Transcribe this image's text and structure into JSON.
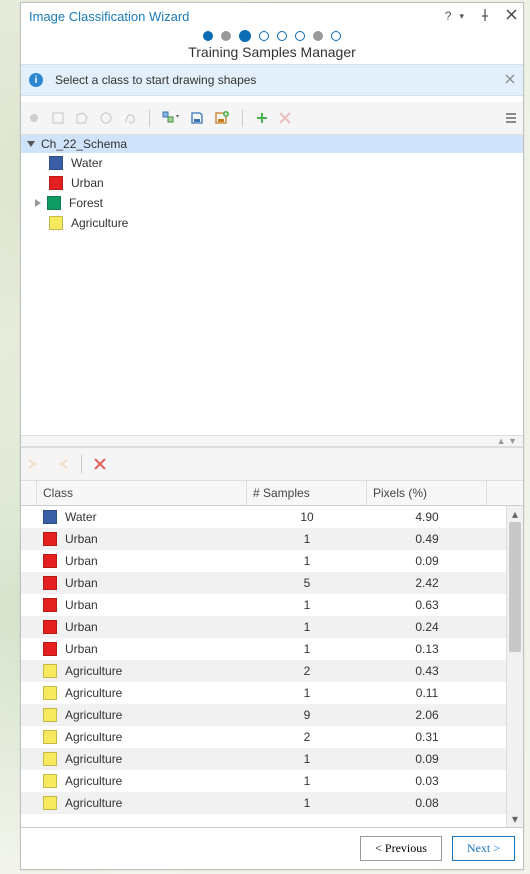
{
  "title": "Image Classification Wizard",
  "step_label": "Training Samples Manager",
  "info_text": "Select a class to start drawing shapes",
  "schema_name": "Ch_22_Schema",
  "classes": [
    {
      "name": "Water",
      "color": "#3a5fa6",
      "expandable": false
    },
    {
      "name": "Urban",
      "color": "#e3201f",
      "expandable": false
    },
    {
      "name": "Forest",
      "color": "#0f9b63",
      "expandable": true
    },
    {
      "name": "Agriculture",
      "color": "#f6e95d",
      "expandable": false
    }
  ],
  "table": {
    "headers": {
      "class": "Class",
      "samples": "# Samples",
      "pixels": "Pixels (%)"
    },
    "rows": [
      {
        "class": "Water",
        "color": "#3a5fa6",
        "samples": "10",
        "pixels": "4.90"
      },
      {
        "class": "Urban",
        "color": "#e3201f",
        "samples": "1",
        "pixels": "0.49"
      },
      {
        "class": "Urban",
        "color": "#e3201f",
        "samples": "1",
        "pixels": "0.09"
      },
      {
        "class": "Urban",
        "color": "#e3201f",
        "samples": "5",
        "pixels": "2.42"
      },
      {
        "class": "Urban",
        "color": "#e3201f",
        "samples": "1",
        "pixels": "0.63"
      },
      {
        "class": "Urban",
        "color": "#e3201f",
        "samples": "1",
        "pixels": "0.24"
      },
      {
        "class": "Urban",
        "color": "#e3201f",
        "samples": "1",
        "pixels": "0.13"
      },
      {
        "class": "Agriculture",
        "color": "#f6e95d",
        "samples": "2",
        "pixels": "0.43"
      },
      {
        "class": "Agriculture",
        "color": "#f6e95d",
        "samples": "1",
        "pixels": "0.11"
      },
      {
        "class": "Agriculture",
        "color": "#f6e95d",
        "samples": "9",
        "pixels": "2.06"
      },
      {
        "class": "Agriculture",
        "color": "#f6e95d",
        "samples": "2",
        "pixels": "0.31"
      },
      {
        "class": "Agriculture",
        "color": "#f6e95d",
        "samples": "1",
        "pixels": "0.09"
      },
      {
        "class": "Agriculture",
        "color": "#f6e95d",
        "samples": "1",
        "pixels": "0.03"
      },
      {
        "class": "Agriculture",
        "color": "#f6e95d",
        "samples": "1",
        "pixels": "0.08"
      }
    ]
  },
  "buttons": {
    "prev": "< Previous",
    "next": "Next >"
  }
}
